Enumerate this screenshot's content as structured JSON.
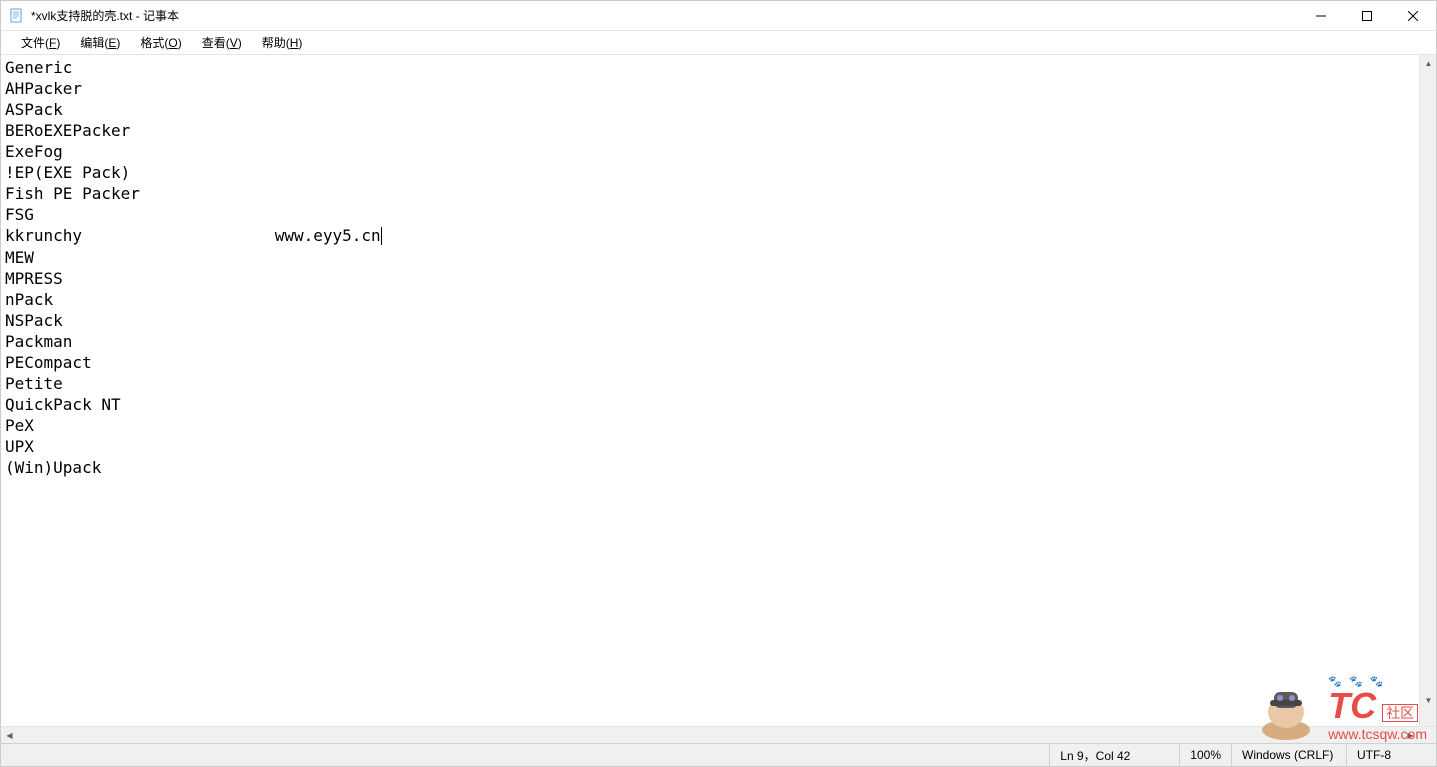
{
  "title": "*xvlk支持脱的壳.txt - 记事本",
  "menu": {
    "file": "文件(F)",
    "edit": "编辑(E)",
    "format": "格式(O)",
    "view": "查看(V)",
    "help": "帮助(H)"
  },
  "content": "Generic\nAHPacker\nASPack\nBERoEXEPacker\nExeFog\n!EP(EXE Pack)\nFish PE Packer\nFSG\nkkrunchy                    www.eyy5.cn\nMEW\nMPRESS\nnPack\nNSPack\nPackman\nPECompact\nPetite\nQuickPack NT\nPeX\nUPX\n(Win)Upack",
  "status": {
    "position": "Ln 9，Col 42",
    "zoom": "100%",
    "line_ending": "Windows (CRLF)",
    "encoding": "UTF-8"
  },
  "watermark": {
    "tc": "TC",
    "sq": "社区",
    "url": "www.tcsqw.com",
    "paws": "🐾 🐾 🐾"
  }
}
